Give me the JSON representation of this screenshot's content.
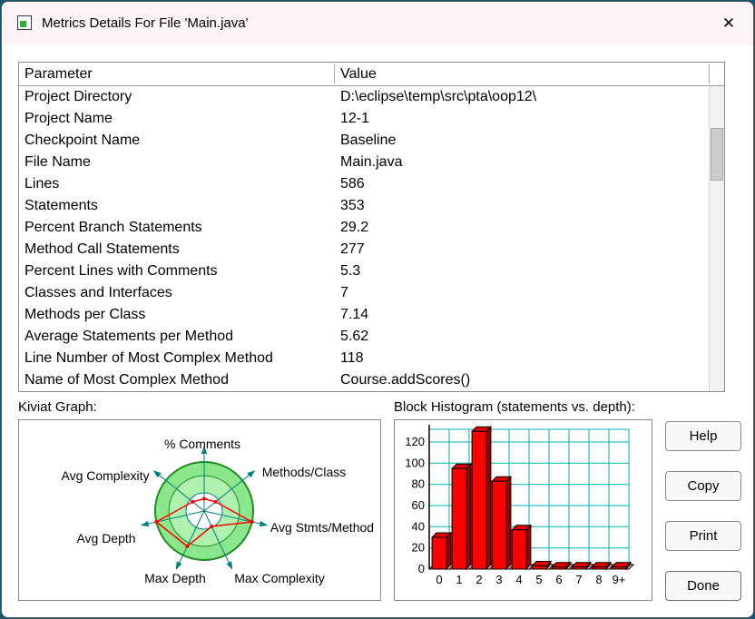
{
  "window": {
    "title": "Metrics Details For File 'Main.java'",
    "close_glyph": "✕"
  },
  "table": {
    "columns": [
      "Parameter",
      "Value"
    ],
    "rows": [
      {
        "parameter": "Project Directory",
        "value": "D:\\eclipse\\temp\\src\\pta\\oop12\\"
      },
      {
        "parameter": "Project Name",
        "value": "12-1"
      },
      {
        "parameter": "Checkpoint Name",
        "value": "Baseline"
      },
      {
        "parameter": "File Name",
        "value": "Main.java"
      },
      {
        "parameter": "Lines",
        "value": "586"
      },
      {
        "parameter": "Statements",
        "value": "353"
      },
      {
        "parameter": "Percent Branch Statements",
        "value": "29.2"
      },
      {
        "parameter": "Method Call Statements",
        "value": "277"
      },
      {
        "parameter": "Percent Lines with Comments",
        "value": "5.3"
      },
      {
        "parameter": "Classes and Interfaces",
        "value": "7"
      },
      {
        "parameter": "Methods per Class",
        "value": "7.14"
      },
      {
        "parameter": "Average Statements per Method",
        "value": "5.62"
      },
      {
        "parameter": "Line Number of Most Complex Method",
        "value": "118"
      },
      {
        "parameter": "Name of Most Complex Method",
        "value": "Course.addScores()"
      }
    ]
  },
  "sections": {
    "kiviat_label": "Kiviat Graph:",
    "histogram_label": "Block Histogram (statements vs. depth):"
  },
  "buttons": [
    "Help",
    "Copy",
    "Print",
    "Done"
  ],
  "chart_data": [
    {
      "type": "radar",
      "title": "Kiviat Graph",
      "axes": [
        "% Comments",
        "Methods/Class",
        "Avg Stmts/Method",
        "Max Complexity",
        "Max Depth",
        "Avg Depth",
        "Avg Complexity"
      ],
      "values": [
        0.25,
        0.3,
        1.0,
        0.35,
        0.8,
        1.0,
        0.3
      ],
      "scale": "fraction of outer circle radius",
      "colors": {
        "ring_outer": "#8ce68c",
        "ring_inner": "#aef0ae",
        "ring_stroke": "#1e8c1e",
        "spoke": "#007f7f",
        "data": "#ff0000"
      }
    },
    {
      "type": "bar",
      "title": "Block Histogram (statements vs. depth)",
      "categories": [
        "0",
        "1",
        "2",
        "3",
        "4",
        "5",
        "6",
        "7",
        "8",
        "9+"
      ],
      "values": [
        30,
        95,
        130,
        83,
        37,
        3,
        2,
        2,
        2,
        2
      ],
      "xlabel": "depth",
      "ylabel": "statements",
      "ylim": [
        0,
        132
      ],
      "yticks": [
        0,
        20,
        40,
        60,
        80,
        100,
        120
      ],
      "grid": true,
      "colors": {
        "bar_front": "#ff0000",
        "bar_top": "#e00000",
        "bar_side": "#9c0000",
        "grid": "#00b0b0"
      }
    }
  ]
}
